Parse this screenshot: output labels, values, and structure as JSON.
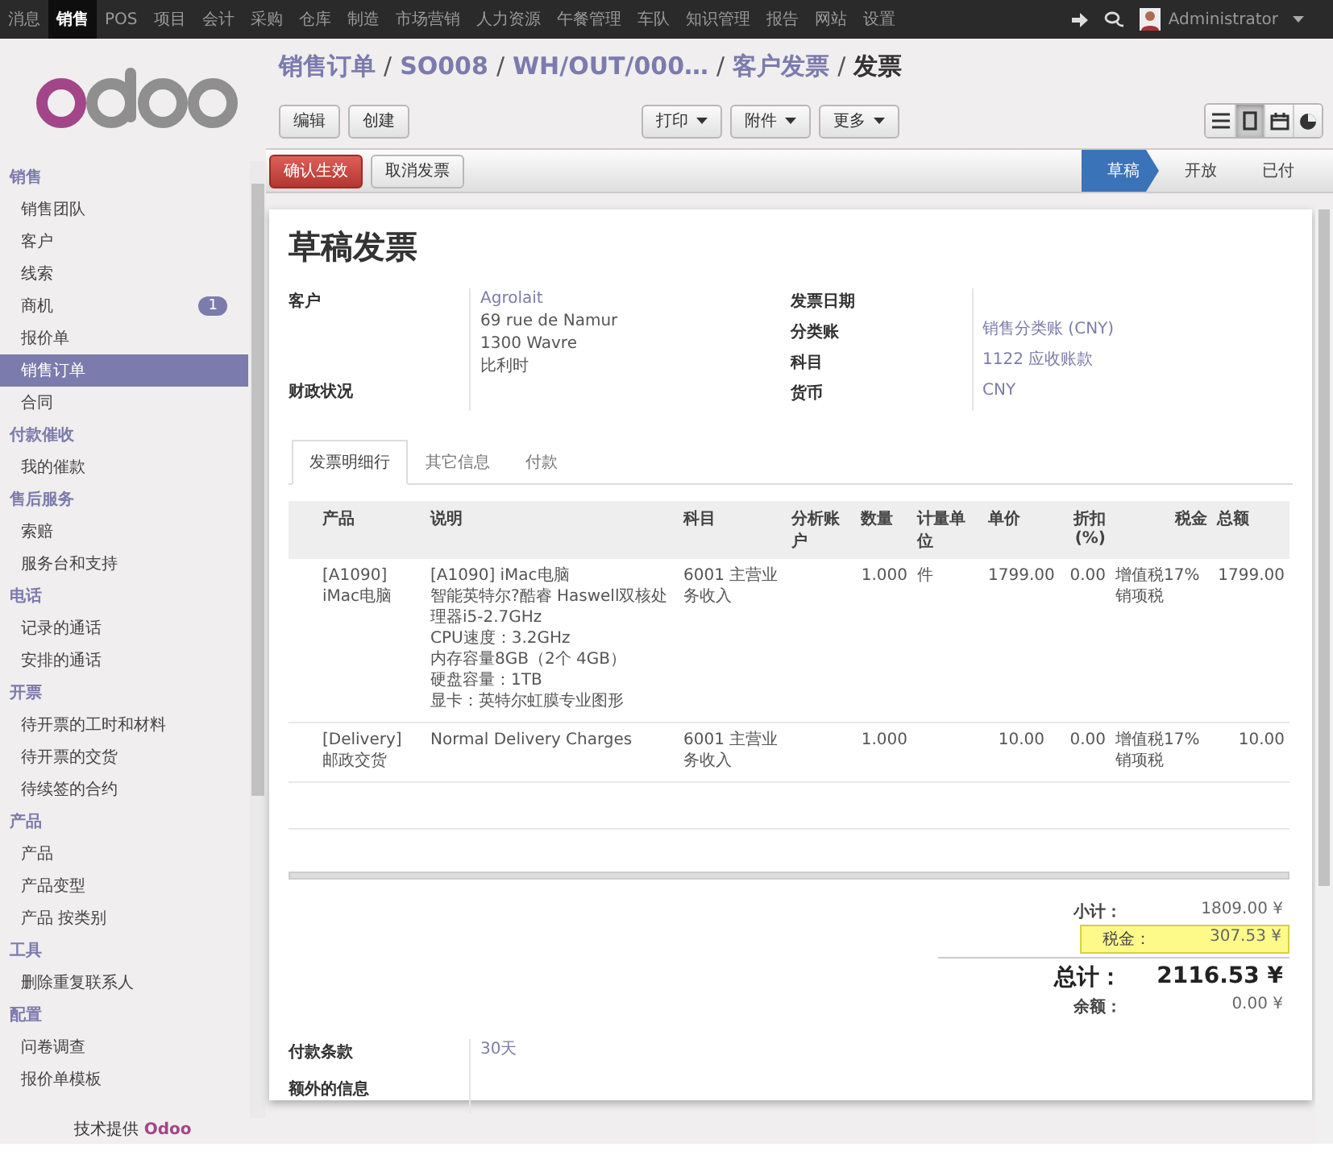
{
  "top_menu": [
    {
      "label": "消息",
      "selected": false
    },
    {
      "label": "销售",
      "selected": true
    },
    {
      "label": "POS",
      "selected": false
    },
    {
      "label": "项目",
      "selected": false
    },
    {
      "label": "会计",
      "selected": false
    },
    {
      "label": "采购",
      "selected": false
    },
    {
      "label": "仓库",
      "selected": false
    },
    {
      "label": "制造",
      "selected": false
    },
    {
      "label": "市场营销",
      "selected": false
    },
    {
      "label": "人力资源",
      "selected": false
    },
    {
      "label": "午餐管理",
      "selected": false
    },
    {
      "label": "车队",
      "selected": false
    },
    {
      "label": "知识管理",
      "selected": false
    },
    {
      "label": "报告",
      "selected": false
    },
    {
      "label": "网站",
      "selected": false
    },
    {
      "label": "设置",
      "selected": false
    }
  ],
  "user": {
    "name": "Administrator"
  },
  "sidebar": {
    "sections": [
      {
        "title": "销售",
        "items": [
          {
            "label": "销售团队",
            "selected": false
          },
          {
            "label": "客户",
            "selected": false
          },
          {
            "label": "线索",
            "selected": false
          },
          {
            "label": "商机",
            "selected": false,
            "badge": "1"
          },
          {
            "label": "报价单",
            "selected": false
          },
          {
            "label": "销售订单",
            "selected": true
          },
          {
            "label": "合同",
            "selected": false
          }
        ]
      },
      {
        "title": "付款催收",
        "items": [
          {
            "label": "我的催款",
            "selected": false
          }
        ]
      },
      {
        "title": "售后服务",
        "items": [
          {
            "label": "索赔",
            "selected": false
          },
          {
            "label": "服务台和支持",
            "selected": false
          }
        ]
      },
      {
        "title": "电话",
        "items": [
          {
            "label": "记录的通话",
            "selected": false
          },
          {
            "label": "安排的通话",
            "selected": false
          }
        ]
      },
      {
        "title": "开票",
        "items": [
          {
            "label": "待开票的工时和材料",
            "selected": false
          },
          {
            "label": "待开票的交货",
            "selected": false
          },
          {
            "label": "待续签的合约",
            "selected": false
          }
        ]
      },
      {
        "title": "产品",
        "items": [
          {
            "label": "产品",
            "selected": false
          },
          {
            "label": "产品变型",
            "selected": false
          },
          {
            "label": "产品 按类别",
            "selected": false
          }
        ]
      },
      {
        "title": "工具",
        "items": [
          {
            "label": "删除重复联系人",
            "selected": false
          }
        ]
      },
      {
        "title": "配置",
        "items": [
          {
            "label": "问卷调查",
            "selected": false
          },
          {
            "label": "报价单模板",
            "selected": false
          }
        ]
      }
    ],
    "footer": "技术提供 **Odoo**"
  },
  "breadcrumb": [
    {
      "kind": "link",
      "text": "销售订单"
    },
    {
      "kind": "sep",
      "text": "/"
    },
    {
      "kind": "link",
      "text": "SO008"
    },
    {
      "kind": "sep",
      "text": "/"
    },
    {
      "kind": "link",
      "text": "WH/OUT/000…"
    },
    {
      "kind": "sep",
      "text": "/"
    },
    {
      "kind": "link",
      "text": "客户发票"
    },
    {
      "kind": "sep",
      "text": "/"
    },
    {
      "kind": "current",
      "text": "发票"
    }
  ],
  "left_buttons": [
    "编辑",
    "创建"
  ],
  "dropdowns": [
    "打印",
    "附件",
    "更多"
  ],
  "views": [
    {
      "kind": "list",
      "selected": false
    },
    {
      "kind": "form",
      "selected": true
    },
    {
      "kind": "calendar",
      "selected": false
    },
    {
      "kind": "graph",
      "selected": false
    }
  ],
  "actions": [
    {
      "label": "确认生效",
      "kind": "primary"
    },
    {
      "label": "取消发票",
      "kind": "default"
    }
  ],
  "stages": [
    {
      "label": "草稿",
      "selected": true
    },
    {
      "label": "开放",
      "selected": false
    },
    {
      "label": "已付",
      "selected": false
    }
  ],
  "form": {
    "title": "草稿发票",
    "left_fields": [
      {
        "label": "客户",
        "link": "Agrolait",
        "lines": [
          "69 rue de Namur",
          "1300 Wavre",
          "比利时"
        ]
      },
      {
        "label": "财政状况"
      }
    ],
    "right_fields": [
      {
        "label": "发票日期"
      },
      {
        "label": "分类账",
        "link": "销售分类账 (CNY)"
      },
      {
        "label": "科目",
        "link": "1122 应收账款"
      },
      {
        "label": "货币",
        "link": "CNY"
      }
    ],
    "tabs": [
      {
        "label": "发票明细行",
        "selected": true
      },
      {
        "label": "其它信息",
        "selected": false
      },
      {
        "label": "付款",
        "selected": false
      }
    ],
    "table": {
      "columns": [
        "产品",
        "说明",
        "科目",
        "分析账户",
        "数量",
        "计量单位",
        "单价",
        "折扣(%)",
        "税金",
        "总额"
      ],
      "rows": [
        {
          "product": "[A1090] iMac电脑",
          "description": [
            "[A1090] iMac电脑",
            "智能英特尔?酷睿 Haswell双核处理器i5-2.7GHz",
            "CPU速度：3.2GHz",
            "内存容量8GB（2个 4GB）",
            "硬盘容量：1TB",
            "显卡：英特尔虹膜专业图形"
          ],
          "account": "6001 主营业务收入",
          "qty": "1.000",
          "uom": "件",
          "price": "1799.00",
          "discount": "0.00",
          "tax": "增值税17%销项税",
          "total": "1799.00"
        },
        {
          "product": "[Delivery] 邮政交货",
          "description": [
            "Normal Delivery Charges"
          ],
          "account": "6001 主营业务收入",
          "qty": "1.000",
          "price": "10.00",
          "discount": "0.00",
          "tax": "增值税17%销项税",
          "total": "10.00"
        }
      ]
    },
    "totals": [
      {
        "label": "小计：",
        "value": "1809.00 ¥",
        "kind": "normal",
        "highlighted": false
      },
      {
        "label": "税金：",
        "value": "307.53 ¥",
        "kind": "normal",
        "highlighted": true
      },
      {
        "label": "总计：",
        "value": "2116.53 ¥",
        "kind": "grand",
        "highlighted": false
      },
      {
        "label": "余额：",
        "value": "0.00 ¥",
        "kind": "normal",
        "highlighted": false
      }
    ],
    "bottom_fields": [
      {
        "label": "付款条款",
        "link": "30天"
      },
      {
        "label": "额外的信息"
      }
    ]
  }
}
